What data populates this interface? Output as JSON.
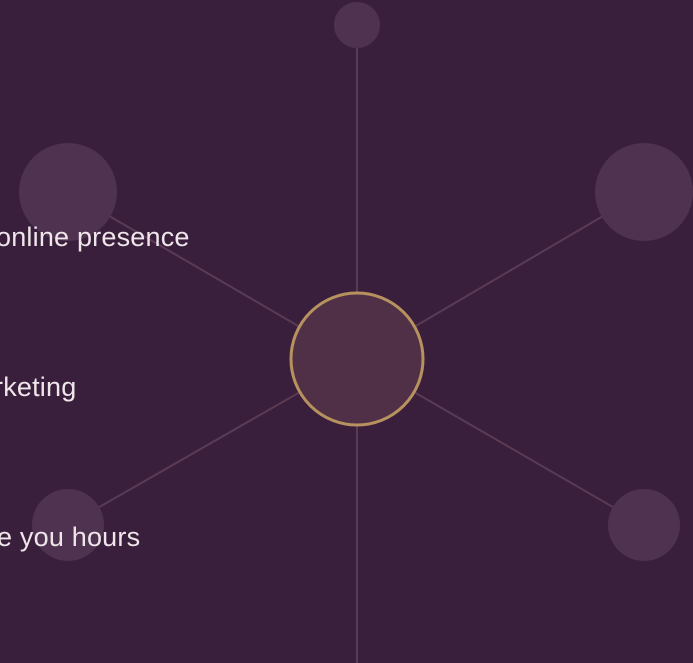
{
  "colors": {
    "background": "#3a1f3d",
    "text": "#efe6ea",
    "hub_fill": "#4f3046",
    "hub_stroke": "#b7925f",
    "spoke": "#5b3b54",
    "node": "#4e3250"
  },
  "bullets": [
    {
      "text": "online presence"
    },
    {
      "text": "rketing"
    },
    {
      "text": "e you hours"
    }
  ],
  "diagram": {
    "hub": {
      "label": "",
      "icon": "empty-circle"
    },
    "nodes": [
      {
        "name": "top"
      },
      {
        "name": "upper-left"
      },
      {
        "name": "upper-right"
      },
      {
        "name": "lower-left"
      },
      {
        "name": "lower-right"
      },
      {
        "name": "bottom"
      }
    ]
  }
}
